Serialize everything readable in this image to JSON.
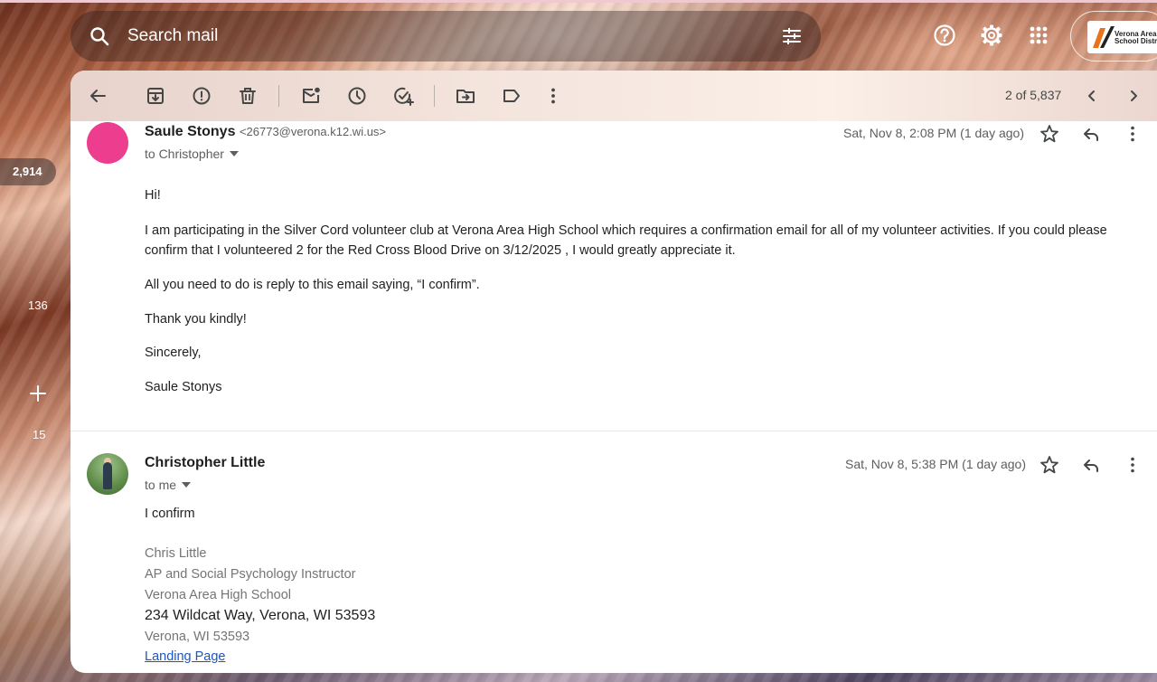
{
  "search": {
    "placeholder": "Search mail"
  },
  "rail": {
    "badge_count": "2,914",
    "count_a": "136",
    "count_b": "15"
  },
  "account": {
    "org_line1": "Verona Area",
    "org_line2": "School District"
  },
  "toolbar": {
    "message_position": "2 of 5,837"
  },
  "messages": [
    {
      "sender_name": "Saule Stonys",
      "sender_email": "<26773@verona.k12.wi.us>",
      "recipient": "to Christopher",
      "date": "Sat, Nov 8, 2:08 PM (1 day ago)",
      "avatar_color": "#ec3d8f",
      "body": [
        "Hi!",
        "I am participating in the Silver Cord volunteer club at Verona Area High School which requires a confirmation email for all of my volunteer activities. If you could please confirm that I volunteered 2 for the Red Cross Blood Drive on 3/12/2025 , I would greatly appreciate it.",
        "All you need to do is reply to this email saying, “I confirm”.",
        "Thank you kindly!",
        "Sincerely,",
        "Saule Stonys"
      ]
    },
    {
      "sender_name": "Christopher Little",
      "recipient": "to me",
      "date": "Sat, Nov 8, 5:38 PM (1 day ago)",
      "body": [
        "I confirm"
      ],
      "signature": {
        "name": "Chris Little",
        "title": "AP and Social Psychology Instructor",
        "school": "Verona Area High School",
        "address": "234 Wildcat Way, Verona, WI 53593",
        "city": "Verona, WI 53593",
        "link": "Landing Page"
      }
    }
  ],
  "colors": {
    "link": "#1a56c8",
    "accent_pink": "#ec3d8f"
  }
}
